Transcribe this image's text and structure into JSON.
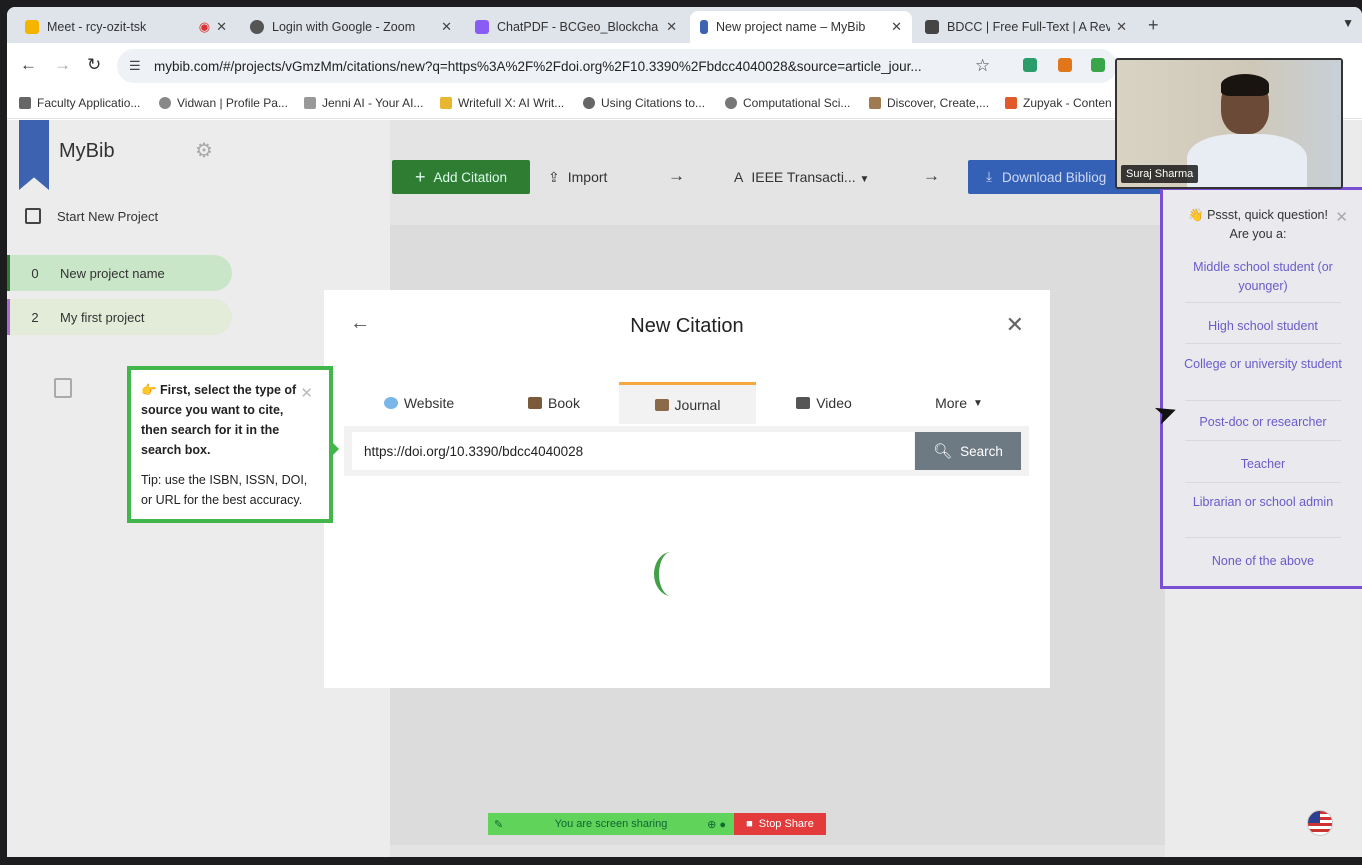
{
  "tabs": [
    {
      "title": "Meet - rcy-ozit-tsk",
      "active": false,
      "color": "#f5b400"
    },
    {
      "title": "Login with Google - Zoom",
      "active": false,
      "color": "#555555"
    },
    {
      "title": "ChatPDF - BCGeo_Blockcha",
      "active": false,
      "color": "#8a5cf6"
    },
    {
      "title": "New project name – MyBib",
      "active": true,
      "color": "#3c62b0"
    },
    {
      "title": "BDCC | Free Full-Text | A Rev",
      "active": false,
      "color": "#444444"
    }
  ],
  "address": {
    "url": "mybib.com/#/projects/vGmzMm/citations/new?q=https%3A%2F%2Fdoi.org%2F10.3390%2Fbdcc4040028&source=article_jour..."
  },
  "bookmarks": [
    "Faculty Applicatio...",
    "Vidwan | Profile Pa...",
    "Jenni AI - Your AI...",
    "Writefull X: AI Writ...",
    "Using Citations to...",
    "Computational Sci...",
    "Discover, Create,...",
    "Zupyak - Conten"
  ],
  "sidebar": {
    "logo": "MyBib",
    "start_new": "Start New Project",
    "projects": [
      {
        "count": "0",
        "name": "New project name"
      },
      {
        "count": "2",
        "name": "My first project"
      }
    ]
  },
  "toolbar": {
    "add": "Add Citation",
    "import": "Import",
    "style": "IEEE Transacti...",
    "download": "Download Bibliog"
  },
  "modal": {
    "title": "New Citation",
    "tabs": [
      "Website",
      "Book",
      "Journal",
      "Video",
      "More"
    ],
    "active_tab": "Journal",
    "search_value": "https://doi.org/10.3390/bdcc4040028",
    "search_button": "Search"
  },
  "tooltip": {
    "line1": "First, select the type of source you want to cite, then search for it in the search box.",
    "line2": "Tip: use the ISBN, ISSN, DOI, or URL for the best accuracy."
  },
  "survey": {
    "question": "Pssst, quick question! Are you a:",
    "options": [
      "Middle school student (or younger)",
      "High school student",
      "College or university student",
      "Post-doc or researcher",
      "Teacher",
      "Librarian or school admin",
      "None of the above"
    ]
  },
  "video": {
    "name": "Suraj Sharma"
  },
  "share": {
    "status": "You are screen sharing",
    "stop": "Stop Share"
  },
  "colors": {
    "accent": "#2e7d32",
    "brand": "#3c62b0",
    "survey_border": "#7a4fd3"
  }
}
